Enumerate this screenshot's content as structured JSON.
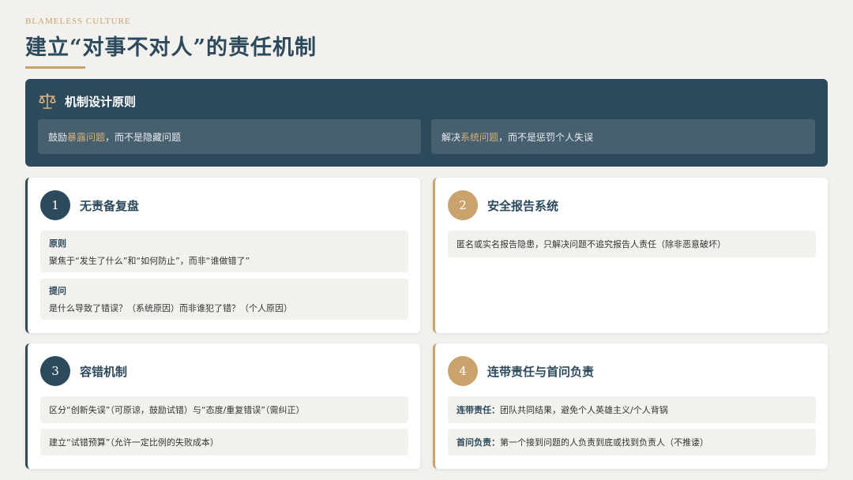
{
  "header": {
    "kicker": "BLAMELESS CULTURE",
    "title": "建立“对事不对人”的责任机制"
  },
  "principles": {
    "title": "机制设计原则",
    "items": [
      {
        "pre": "鼓励",
        "hl": "暴露问题",
        "post": "，而不是隐藏问题"
      },
      {
        "pre": "解决",
        "hl": "系统问题",
        "post": "，而不是惩罚个人失误"
      }
    ]
  },
  "cards": [
    {
      "num": "1",
      "title": "无责备复盘",
      "items": [
        {
          "label": "原则",
          "text": "聚焦于“发生了什么”和“如何防止”，而非“谁做错了”"
        },
        {
          "label": "提问",
          "text": "是什么导致了错误？（系统原因）而非谁犯了错？（个人原因）"
        }
      ]
    },
    {
      "num": "2",
      "title": "安全报告系统",
      "items": [
        {
          "text": "匿名或实名报告隐患，只解决问题不追究报告人责任（除非恶意破坏）"
        }
      ]
    },
    {
      "num": "3",
      "title": "容错机制",
      "items": [
        {
          "text": "区分“创新失误”（可原谅，鼓励试错）与“态度/重复错误”（需纠正）"
        },
        {
          "text": "建立“试错预算”（允许一定比例的失败成本）"
        }
      ]
    },
    {
      "num": "4",
      "title": "连带责任与首问负责",
      "items": [
        {
          "label": "连带责任：",
          "text": "团队共同结果，避免个人英雄主义/个人背锅"
        },
        {
          "label": "首问负责：",
          "text": "第一个接到问题的人负责到底或找到负责人（不推诿）"
        }
      ]
    }
  ]
}
